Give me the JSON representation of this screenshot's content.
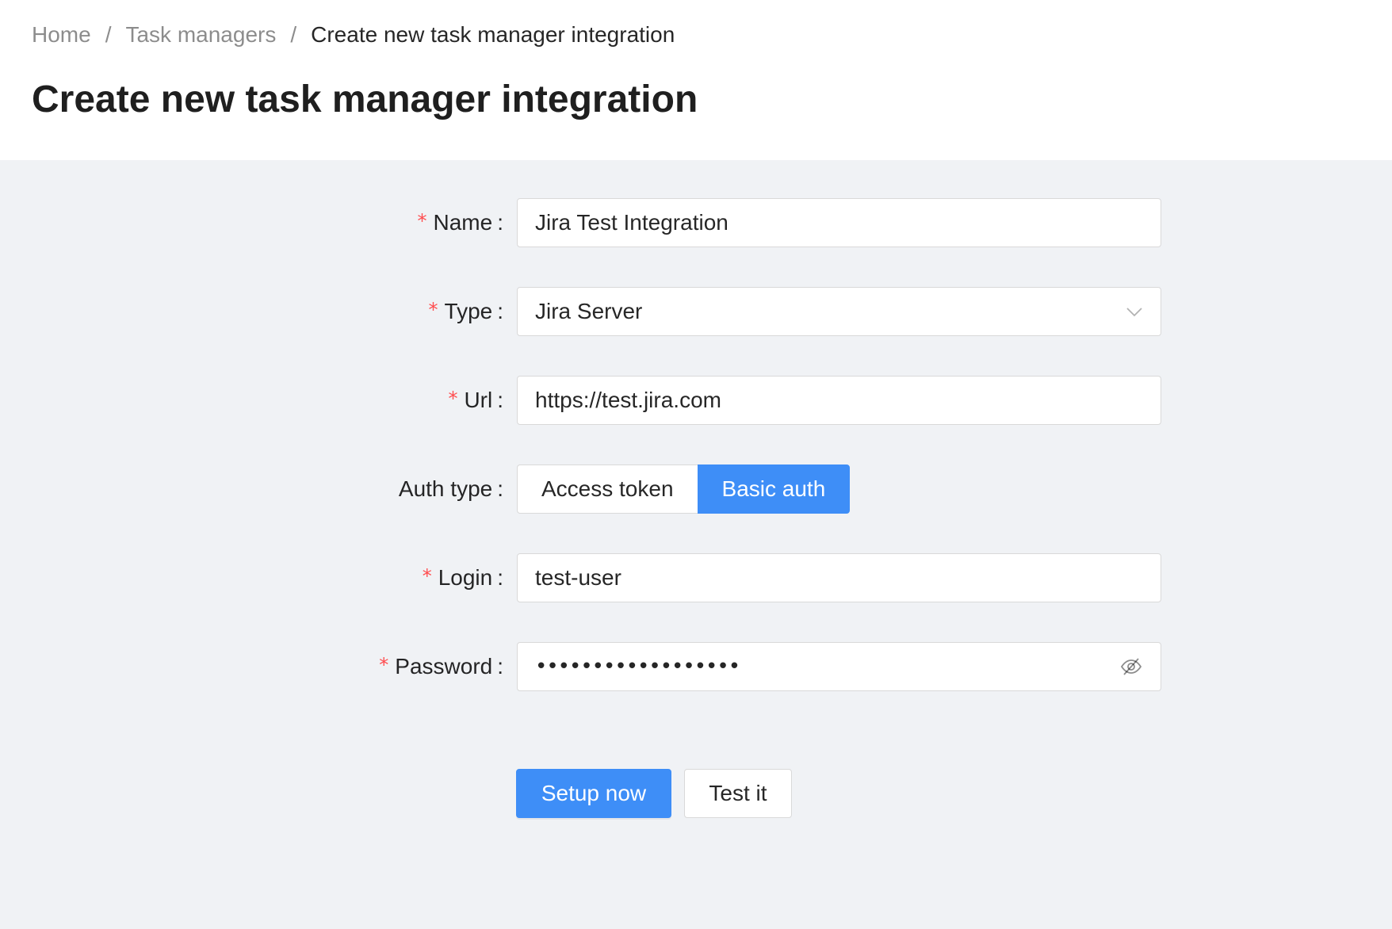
{
  "breadcrumb": {
    "items": [
      "Home",
      "Task managers",
      "Create new task manager integration"
    ],
    "separator": "/"
  },
  "page": {
    "title": "Create new task manager integration"
  },
  "form": {
    "name": {
      "label": "Name",
      "required": true,
      "value": "Jira Test Integration"
    },
    "type": {
      "label": "Type",
      "required": true,
      "value": "Jira Server"
    },
    "url": {
      "label": "Url",
      "required": true,
      "value": "https://test.jira.com"
    },
    "auth_type": {
      "label": "Auth type",
      "required": false,
      "options": [
        "Access token",
        "Basic auth"
      ],
      "selected": "Basic auth"
    },
    "login": {
      "label": "Login",
      "required": true,
      "value": "test-user"
    },
    "password": {
      "label": "Password",
      "required": true,
      "masked": "••••••••••••••••••"
    },
    "colon": ":",
    "required_mark": "*"
  },
  "actions": {
    "setup_label": "Setup now",
    "test_label": "Test it"
  },
  "colors": {
    "primary": "#3e8ef7",
    "required": "#ff4d4f",
    "background": "#f0f2f5"
  }
}
